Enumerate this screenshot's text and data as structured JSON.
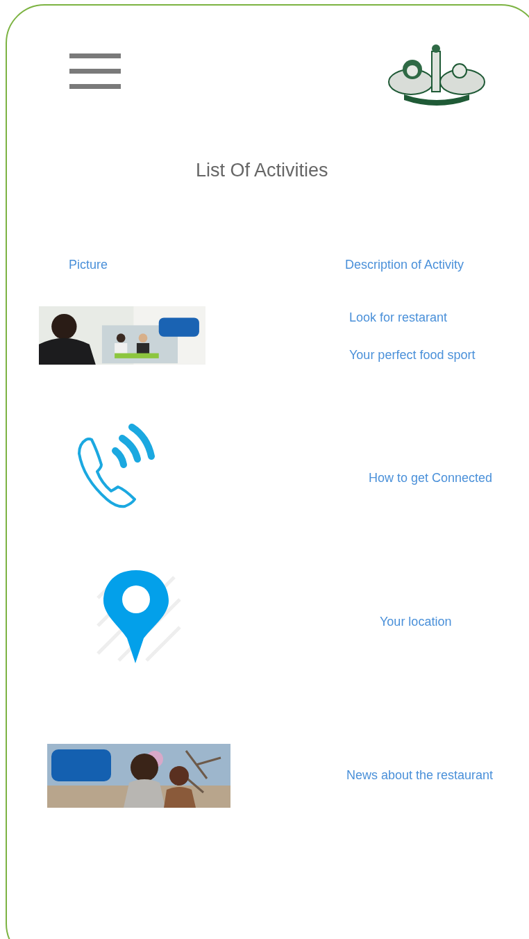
{
  "header": {
    "title": "List Of Activities"
  },
  "columns": [
    "Picture",
    "Description of Activity"
  ],
  "rows": [
    {
      "kind": "meeting",
      "descriptions": [
        "Look for restarant",
        "Your perfect food sport"
      ]
    },
    {
      "kind": "phone",
      "descriptions": [
        "How to get Connected"
      ]
    },
    {
      "kind": "pin",
      "descriptions": [
        "Your location"
      ]
    },
    {
      "kind": "outdoor",
      "descriptions": [
        "News about the restaurant"
      ]
    }
  ]
}
